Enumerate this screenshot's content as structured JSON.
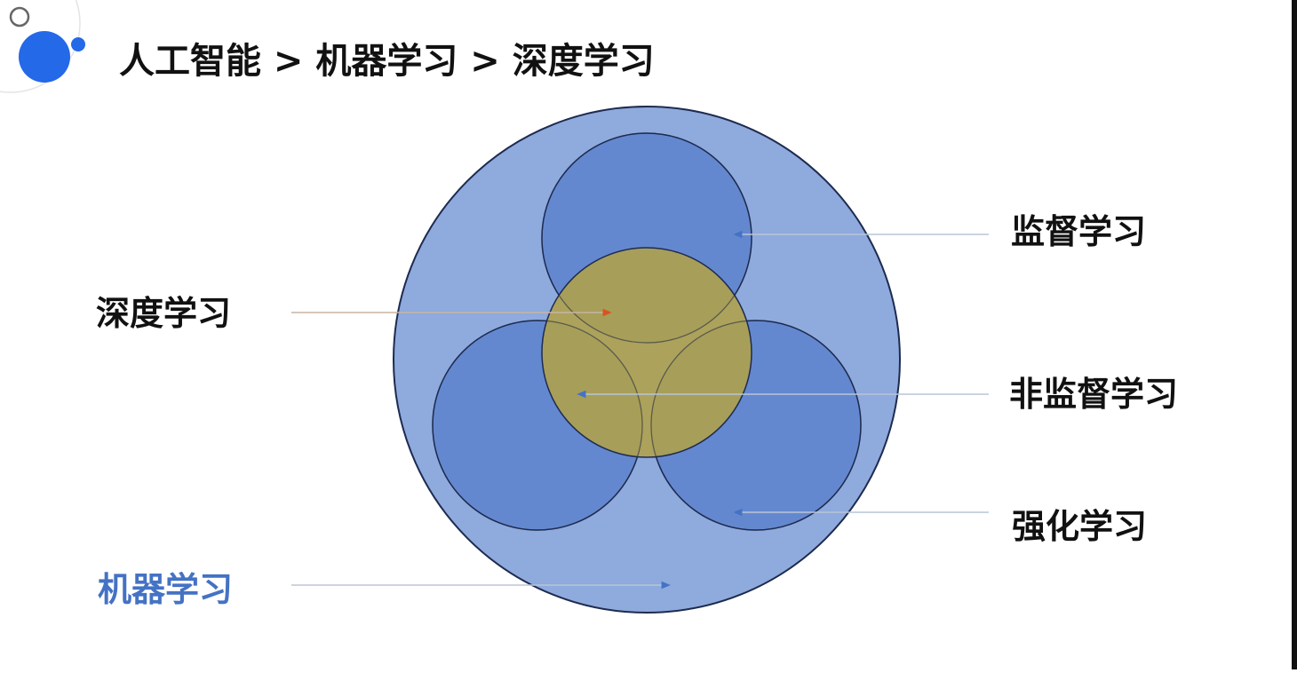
{
  "header": {
    "title": "人工智能 > 机器学习 > 深度学习"
  },
  "diagram": {
    "labels": {
      "supervised": "监督学习",
      "deep_learning": "深度学习",
      "unsupervised": "非监督学习",
      "reinforcement": "强化学习",
      "machine_learning": "机器学习"
    },
    "colors": {
      "outer_circle": "#8faadc",
      "inner_circles": "#6488cf",
      "deep_learning_circle": "#a89a52",
      "outline": "#1d2b50",
      "machine_learning_label": "#4472c4",
      "deep_learning_arrow": "#d9541f",
      "arrow": "#4472c4",
      "accent_dot": "#2369e8"
    }
  }
}
